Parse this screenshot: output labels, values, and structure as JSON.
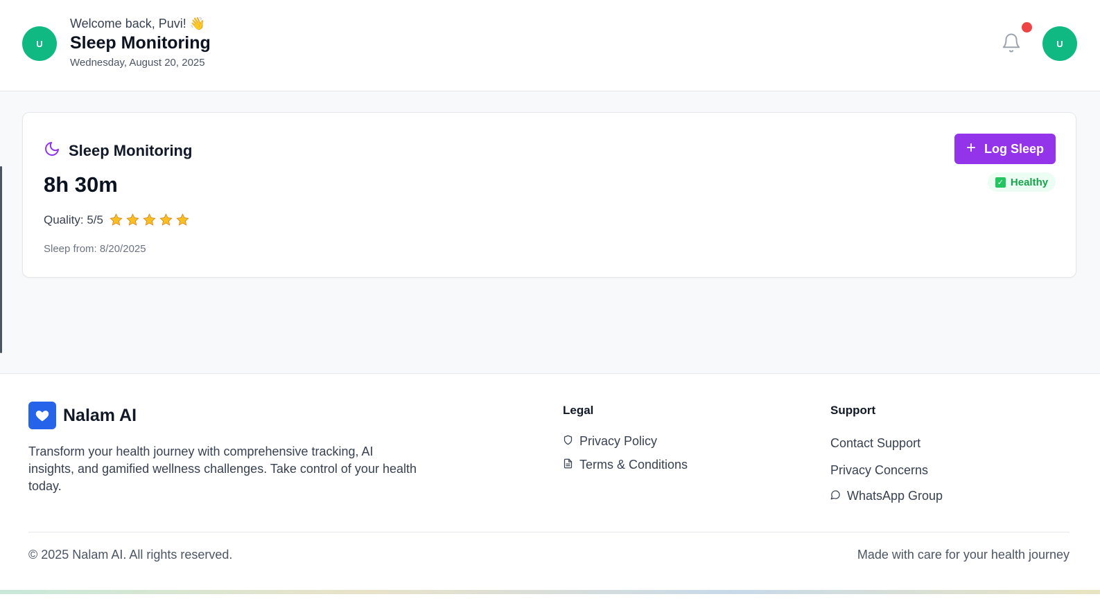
{
  "header": {
    "avatar_initial": "U",
    "welcome": "Welcome back, Puvi! 👋",
    "title": "Sleep Monitoring",
    "date": "Wednesday, August 20, 2025",
    "profile_initial": "U"
  },
  "card": {
    "title": "Sleep Monitoring",
    "duration": "8h 30m",
    "quality_label": "Quality: 5/5",
    "quality_rating": 5,
    "quality_max": 5,
    "sleep_from": "Sleep from: 8/20/2025",
    "log_button": "Log Sleep",
    "status_badge": "Healthy"
  },
  "footer": {
    "brand": "Nalam AI",
    "description": "Transform your health journey with comprehensive tracking, AI insights, and gamified wellness challenges. Take control of your health today.",
    "legal": {
      "title": "Legal",
      "links": [
        "Privacy Policy",
        "Terms & Conditions"
      ]
    },
    "support": {
      "title": "Support",
      "links": [
        "Contact Support",
        "Privacy Concerns",
        "WhatsApp Group"
      ]
    },
    "copyright": "© 2025 Nalam AI. All rights reserved.",
    "tagline": "Made with care for your health journey"
  },
  "colors": {
    "accent": "#9333ea",
    "avatar": "#10b981",
    "brand": "#2563eb",
    "healthy": "#16a34a",
    "notification": "#ef4444",
    "star": "#fbbf24"
  },
  "icons": [
    "moon-icon",
    "bell-icon",
    "plus-icon",
    "check-icon",
    "star-icon",
    "heart-icon",
    "shield-icon",
    "document-icon",
    "chat-icon"
  ]
}
